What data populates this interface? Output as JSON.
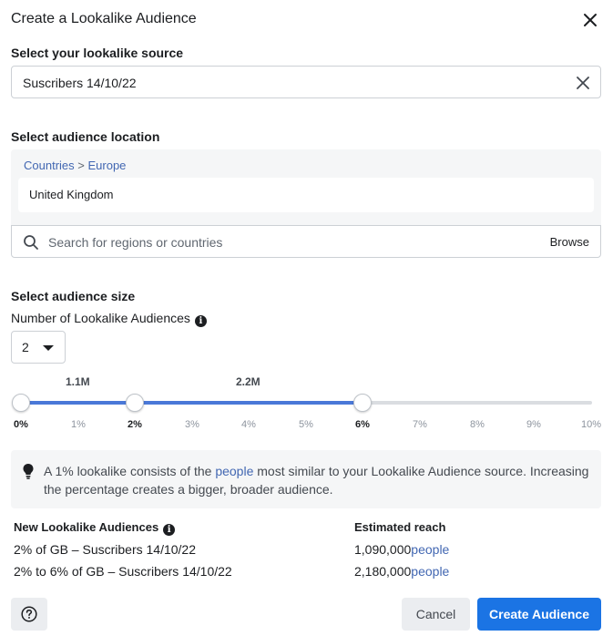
{
  "dialog": {
    "title": "Create a Lookalike Audience"
  },
  "source": {
    "label": "Select your lookalike source",
    "value": "Suscribers 14/10/22"
  },
  "location": {
    "label": "Select audience location",
    "breadcrumb_countries": "Countries",
    "breadcrumb_separator": ">",
    "breadcrumb_region": "Europe",
    "selected_country": "United Kingdom",
    "search_placeholder": "Search for regions or countries",
    "browse_label": "Browse"
  },
  "size": {
    "label": "Select audience size",
    "number_label": "Number of Lookalike Audiences",
    "number_value": "2",
    "reach_marks": [
      "1.1M",
      "2.2M"
    ],
    "ticks": [
      "0%",
      "1%",
      "2%",
      "3%",
      "4%",
      "5%",
      "6%",
      "7%",
      "8%",
      "9%",
      "10%"
    ],
    "selected_percents": [
      0,
      2,
      6
    ]
  },
  "tip": {
    "prefix": "A 1% lookalike consists of the ",
    "link": "people",
    "suffix": " most similar to your Lookalike Audience source. Increasing the percentage creates a bigger, broader audience."
  },
  "summary": {
    "col_audiences": "New Lookalike Audiences",
    "col_reach": "Estimated reach",
    "rows": [
      {
        "name": "2% of GB – Suscribers 14/10/22",
        "reach": "1,090,000",
        "unit": "people"
      },
      {
        "name": "2% to 6% of GB – Suscribers 14/10/22",
        "reach": "2,180,000",
        "unit": "people"
      }
    ]
  },
  "footer": {
    "cancel_label": "Cancel",
    "create_label": "Create Audience"
  },
  "colors": {
    "accent": "#1b74e4",
    "link": "#4267b2",
    "slider_fill": "#4a78d8"
  }
}
